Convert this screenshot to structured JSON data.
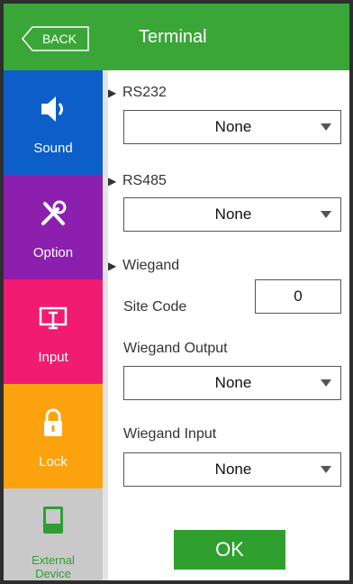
{
  "header": {
    "back_label": "BACK",
    "title": "Terminal",
    "background": "#3aa637"
  },
  "sidebar": {
    "items": [
      {
        "label": "Sound",
        "icon": "speaker-icon",
        "color": "#0d5ec9"
      },
      {
        "label": "Option",
        "icon": "tools-icon",
        "color": "#8d1fae"
      },
      {
        "label": "Input",
        "icon": "input-panel-icon",
        "color": "#f11b72"
      },
      {
        "label": "Lock",
        "icon": "lock-icon",
        "color": "#fda20f"
      },
      {
        "label_line1": "External",
        "label_line2": "Device",
        "icon": "external-device-icon",
        "color": "#c9c9c9",
        "selected": true
      }
    ]
  },
  "main": {
    "rs232": {
      "heading": "RS232",
      "value": "None"
    },
    "rs485": {
      "heading": "RS485",
      "value": "None"
    },
    "wiegand": {
      "heading": "Wiegand",
      "site_code_label": "Site Code",
      "site_code_value": "0",
      "output_label": "Wiegand Output",
      "output_value": "None",
      "input_label": "Wiegand Input",
      "input_value": "None"
    },
    "ok_label": "OK"
  }
}
